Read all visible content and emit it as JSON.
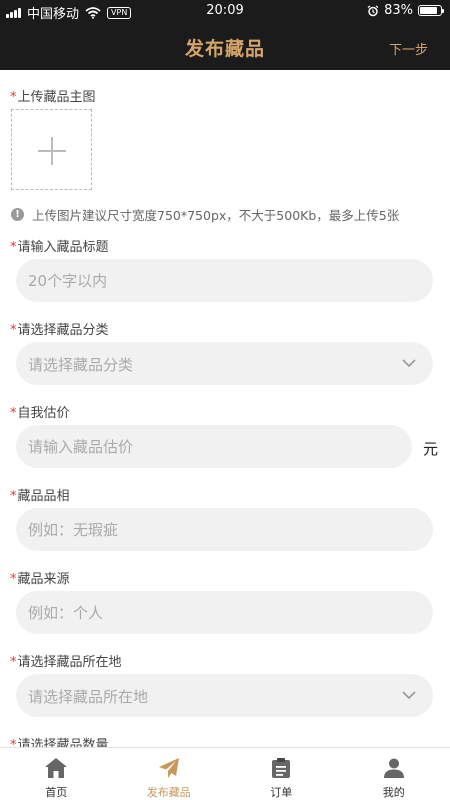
{
  "status_bar": {
    "carrier": "中国移动",
    "vpn": "VPN",
    "time": "20:09",
    "battery": "83%",
    "battery_level": 0.83
  },
  "nav": {
    "title": "发布藏品",
    "next_label": "下一步",
    "accent_color": "#d4a56a"
  },
  "form": {
    "required_mark": "*",
    "upload": {
      "label": "上传藏品主图",
      "hint": "上传图片建议尺寸宽度750*750px，不大于500Kb，最多上传5张"
    },
    "title_field": {
      "label": "请输入藏品标题",
      "placeholder": "20个字以内"
    },
    "category_field": {
      "label": "请选择藏品分类",
      "placeholder": "请选择藏品分类"
    },
    "price_field": {
      "label": "自我估价",
      "placeholder": "请输入藏品估价",
      "unit": "元"
    },
    "condition_field": {
      "label": "藏品品相",
      "placeholder": "例如：无瑕疵"
    },
    "source_field": {
      "label": "藏品来源",
      "placeholder": "例如：个人"
    },
    "location_field": {
      "label": "请选择藏品所在地",
      "placeholder": "请选择藏品所在地"
    },
    "quantity_field": {
      "label": "请选择藏品数量"
    }
  },
  "tab_bar": {
    "active_color": "#c8975a",
    "tabs": [
      {
        "label": "首页",
        "icon": "home-icon"
      },
      {
        "label": "发布藏品",
        "icon": "paper-plane-icon",
        "active": true
      },
      {
        "label": "订单",
        "icon": "clipboard-icon"
      },
      {
        "label": "我的",
        "icon": "user-icon"
      }
    ]
  }
}
